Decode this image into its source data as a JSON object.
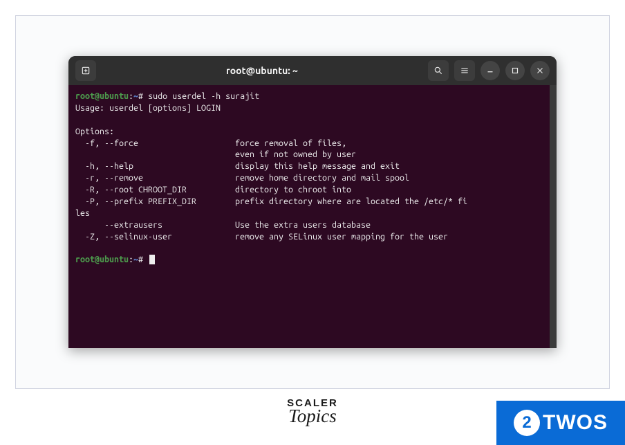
{
  "window": {
    "title": "root@ubuntu: ~"
  },
  "terminal": {
    "prompt_user": "root@ubuntu",
    "prompt_sep": ":",
    "prompt_path": "~",
    "prompt_hash": "#",
    "command": " sudo userdel -h surajit",
    "output": "Usage: userdel [options] LOGIN\n\nOptions:\n  -f, --force                    force removal of files,\n                                 even if not owned by user\n  -h, --help                     display this help message and exit\n  -r, --remove                   remove home directory and mail spool\n  -R, --root CHROOT_DIR          directory to chroot into\n  -P, --prefix PREFIX_DIR        prefix directory where are located the /etc/* fi\nles\n      --extrausers               Use the extra users database\n  -Z, --selinux-user             remove any SELinux user mapping for the user\n"
  },
  "brand": {
    "scaler_top": "SCALER",
    "scaler_bot": "Topics"
  },
  "badge": {
    "circle": "2",
    "text": "TWOS"
  }
}
